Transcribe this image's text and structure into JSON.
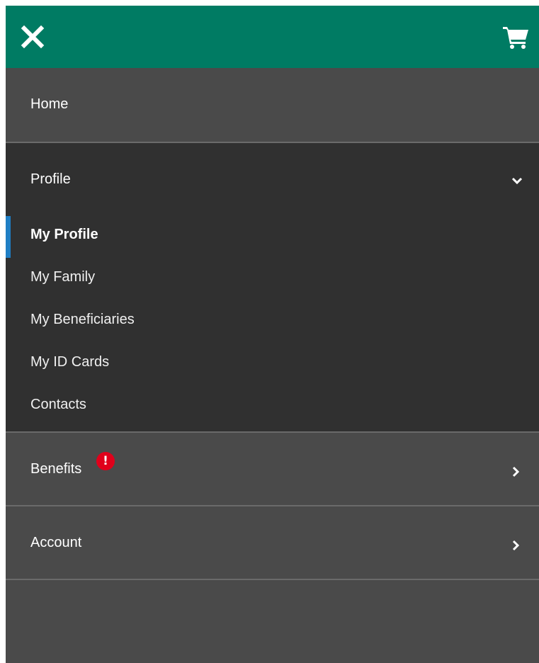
{
  "header": {
    "background_color": "#007b63",
    "close_icon": "close-icon",
    "cart_icon": "shopping-cart-icon"
  },
  "nav": {
    "home": {
      "label": "Home"
    },
    "profile": {
      "label": "Profile",
      "expanded": true,
      "chevron_icon": "chevron-down-icon",
      "items": [
        {
          "label": "My Profile",
          "active": true
        },
        {
          "label": "My Family"
        },
        {
          "label": "My Beneficiaries"
        },
        {
          "label": "My ID Cards"
        },
        {
          "label": "Contacts"
        }
      ]
    },
    "benefits": {
      "label": "Benefits",
      "badge": "!",
      "badge_color": "#e0001b",
      "chevron_icon": "chevron-right-icon"
    },
    "account": {
      "label": "Account",
      "chevron_icon": "chevron-right-icon"
    }
  },
  "colors": {
    "menu_background": "#4a4a4a",
    "submenu_background": "#303030",
    "active_indicator": "#1f7ec4"
  }
}
